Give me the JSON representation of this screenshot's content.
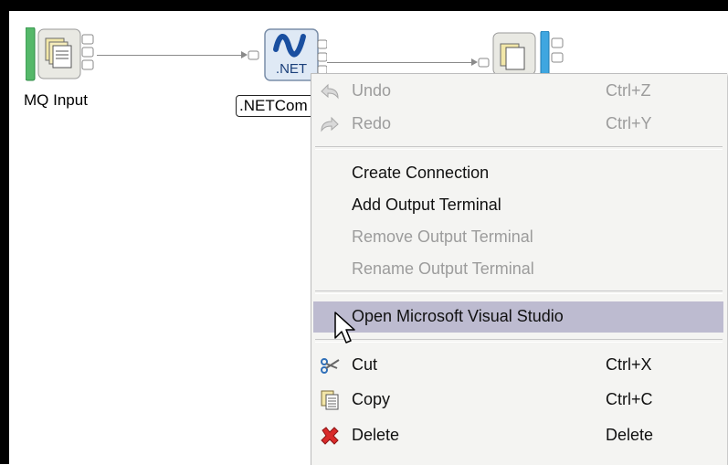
{
  "canvas": {
    "nodes": [
      {
        "id": "mq-input",
        "label": "MQ Input"
      },
      {
        "id": "netcompute",
        "label": ".NETCom",
        "icon_text": ".NET"
      },
      {
        "id": "output",
        "label": ""
      }
    ]
  },
  "context_menu": {
    "items": [
      {
        "label": "Undo",
        "accel": "Ctrl+Z",
        "enabled": false,
        "icon": "undo-icon"
      },
      {
        "label": "Redo",
        "accel": "Ctrl+Y",
        "enabled": false,
        "icon": "redo-icon"
      },
      {
        "label": "Create Connection",
        "enabled": true
      },
      {
        "label": "Add Output Terminal",
        "enabled": true
      },
      {
        "label": "Remove Output Terminal",
        "enabled": false
      },
      {
        "label": "Rename Output Terminal",
        "enabled": false
      },
      {
        "label": "Open Microsoft Visual Studio",
        "enabled": true,
        "highlighted": true
      },
      {
        "label": "Cut",
        "accel": "Ctrl+X",
        "enabled": true,
        "icon": "scissors-icon"
      },
      {
        "label": "Copy",
        "accel": "Ctrl+C",
        "enabled": true,
        "icon": "copy-icon"
      },
      {
        "label": "Delete",
        "accel": "Delete",
        "enabled": true,
        "icon": "delete-icon"
      }
    ]
  },
  "colors": {
    "menu_bg": "#f4f4f2",
    "highlight": "#bdbbd0",
    "disabled_text": "#9c9c9c",
    "mq_input_bar": "#55b86a",
    "output_bar": "#3fa6e0",
    "net_logo": "#1a4fa0"
  }
}
